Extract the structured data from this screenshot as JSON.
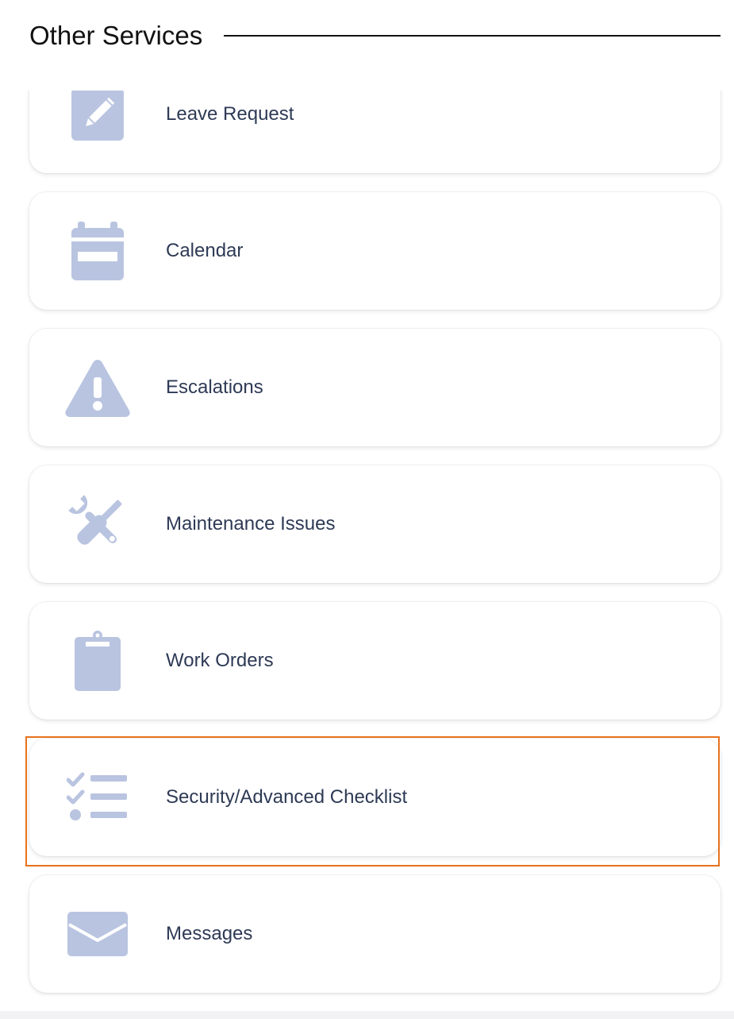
{
  "header": {
    "title": "Other Services"
  },
  "services": [
    {
      "label": "Leave Request",
      "icon": "pencil-square-icon"
    },
    {
      "label": "Calendar",
      "icon": "calendar-icon"
    },
    {
      "label": "Escalations",
      "icon": "warning-triangle-icon"
    },
    {
      "label": "Maintenance Issues",
      "icon": "tools-icon"
    },
    {
      "label": "Work Orders",
      "icon": "clipboard-icon"
    },
    {
      "label": "Security/Advanced Checklist",
      "icon": "checklist-icon"
    },
    {
      "label": "Messages",
      "icon": "envelope-icon"
    }
  ],
  "colors": {
    "icon": "#b9c4e0",
    "label": "#2e3a55",
    "highlight_border": "#e8721c"
  },
  "highlighted_item": "Security/Advanced Checklist"
}
